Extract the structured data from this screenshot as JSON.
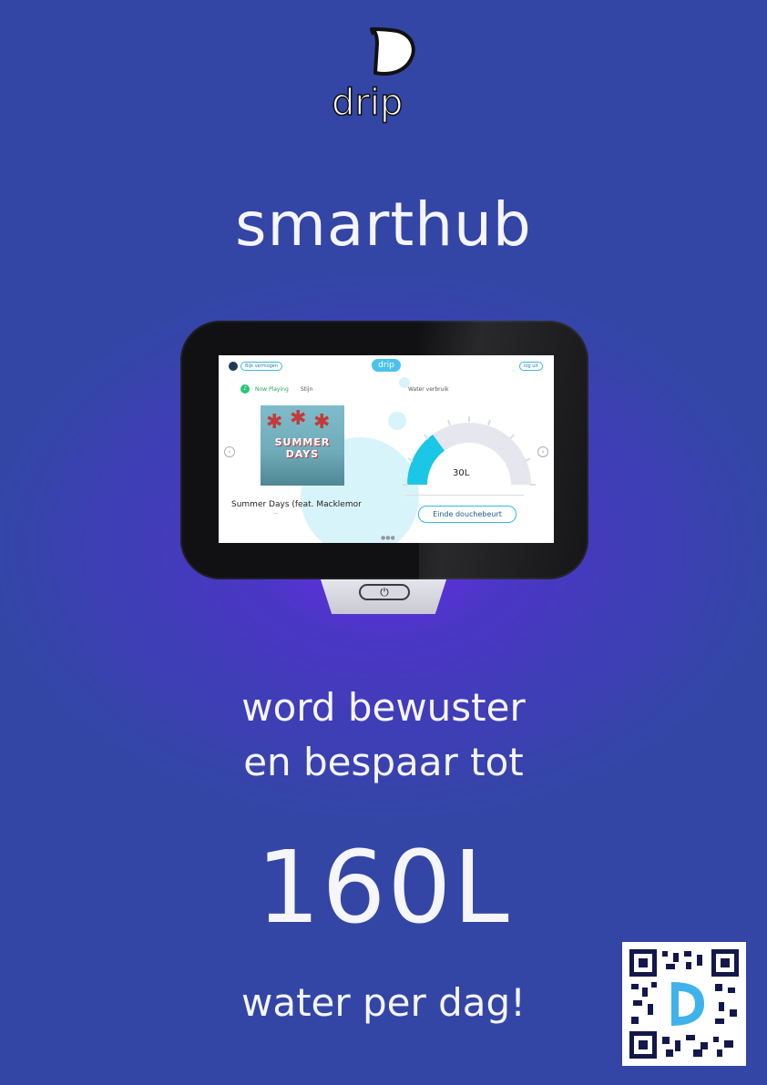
{
  "brand": {
    "logo_text": "drip"
  },
  "poster": {
    "title": "smarthub",
    "line1": "word bewuster",
    "line2": "en bespaar tot",
    "amount": "160L",
    "line3": "water per dag!"
  },
  "device_screen": {
    "header_left_pill": "Bijk vermogen",
    "header_logo": "drip",
    "header_right_pill": "log uit",
    "now_playing_label": "Now Playing",
    "now_playing_app": "Stijn",
    "water_label": "Water verbruik",
    "album_text": "SUMMER DAYS",
    "song_title": "Summer Days (feat. Macklemor",
    "gauge_value": "30L",
    "end_button": "Einde douchebeurt",
    "gauge_fraction": 0.3
  },
  "colors": {
    "background": "#3346a6",
    "glow": "#6c2cec",
    "accent": "#4ac2ec",
    "text": "#f5f5fa"
  },
  "icons": [
    "drip-logo",
    "power-icon",
    "qr-code"
  ]
}
